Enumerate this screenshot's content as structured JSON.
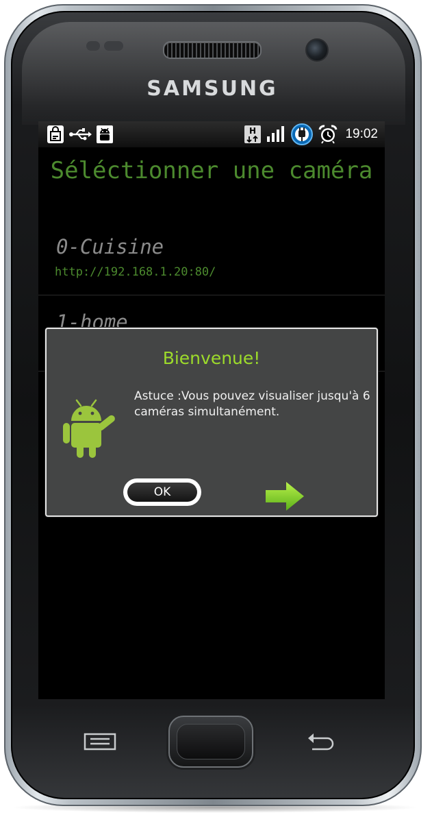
{
  "device": {
    "brand": "SAMSUNG"
  },
  "statusbar": {
    "time": "19:02",
    "icons_left": [
      "shopping-bag-icon",
      "usb-icon",
      "android-debug-icon"
    ],
    "icons_right": [
      "hspa-data-icon",
      "signal-icon",
      "charging-icon",
      "alarm-icon"
    ]
  },
  "app": {
    "title": "Séléctionner une caméra",
    "cameras": [
      {
        "name": "0-Cuisine",
        "url": "http://192.168.1.20:80/"
      },
      {
        "name": "1-home"
      }
    ]
  },
  "dialog": {
    "title": "Bienvenue!",
    "message": "Astuce :Vous pouvez visualiser jusqu'à 6 caméras simultanément.",
    "ok_label": "OK",
    "accent_color": "#9ddb2b"
  },
  "colors": {
    "title_green": "#4c8a2e",
    "dialog_bg": "#444545"
  }
}
